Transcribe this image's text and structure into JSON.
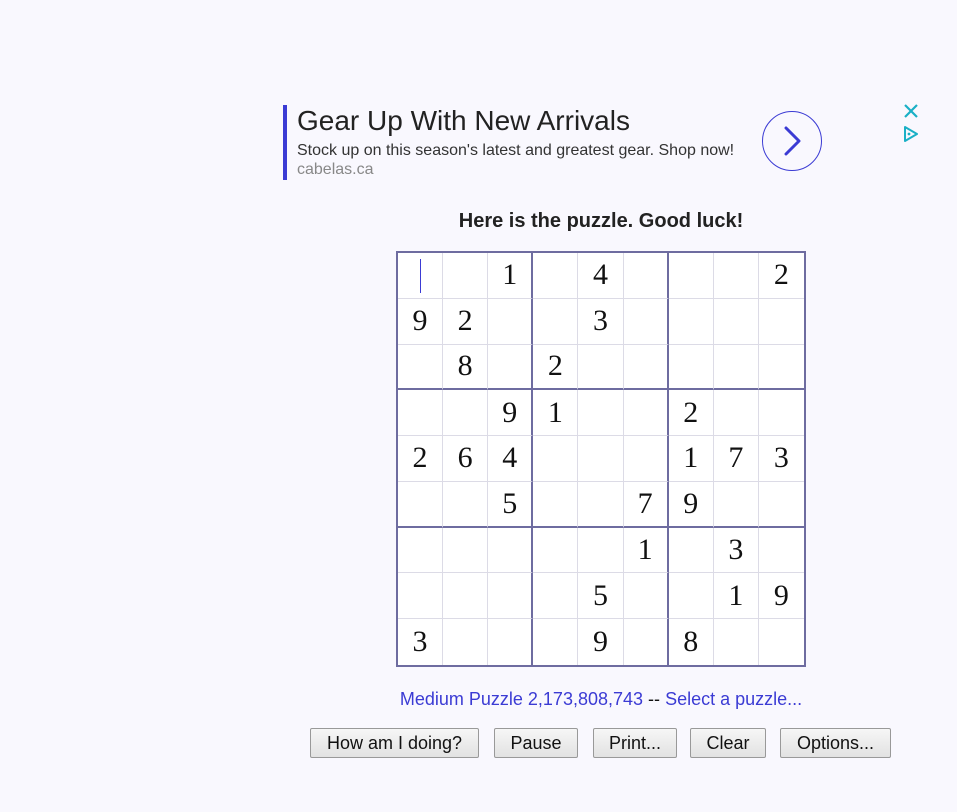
{
  "ad": {
    "title": "Gear Up With New Arrivals",
    "body": "Stock up on this season's latest and greatest gear. Shop now!",
    "url": "cabelas.ca",
    "accent_color": "#3b3bd4",
    "close_icon": "close-icon",
    "choices_icon": "adchoices-icon"
  },
  "heading": "Here is the puzzle. Good luck!",
  "grid": [
    [
      "",
      "",
      "1",
      "",
      "4",
      "",
      "",
      "",
      "2"
    ],
    [
      "9",
      "2",
      "",
      "",
      "3",
      "",
      "",
      "",
      ""
    ],
    [
      "",
      "8",
      "",
      "2",
      "",
      "",
      "",
      "",
      ""
    ],
    [
      "",
      "",
      "9",
      "1",
      "",
      "",
      "2",
      "",
      ""
    ],
    [
      "2",
      "6",
      "4",
      "",
      "",
      "",
      "1",
      "7",
      "3"
    ],
    [
      "",
      "",
      "5",
      "",
      "",
      "7",
      "9",
      "",
      ""
    ],
    [
      "",
      "",
      "",
      "",
      "",
      "1",
      "",
      "3",
      ""
    ],
    [
      "",
      "",
      "",
      "",
      "5",
      "",
      "",
      "1",
      "9"
    ],
    [
      "3",
      "",
      "",
      "",
      "9",
      "",
      "8",
      "",
      ""
    ]
  ],
  "puzzle_info": {
    "label": "Medium Puzzle 2,173,808,743",
    "separator": "--",
    "select_link": "Select a puzzle..."
  },
  "buttons": {
    "how": "How am I doing?",
    "pause": "Pause",
    "print": "Print...",
    "clear": "Clear",
    "options": "Options..."
  }
}
